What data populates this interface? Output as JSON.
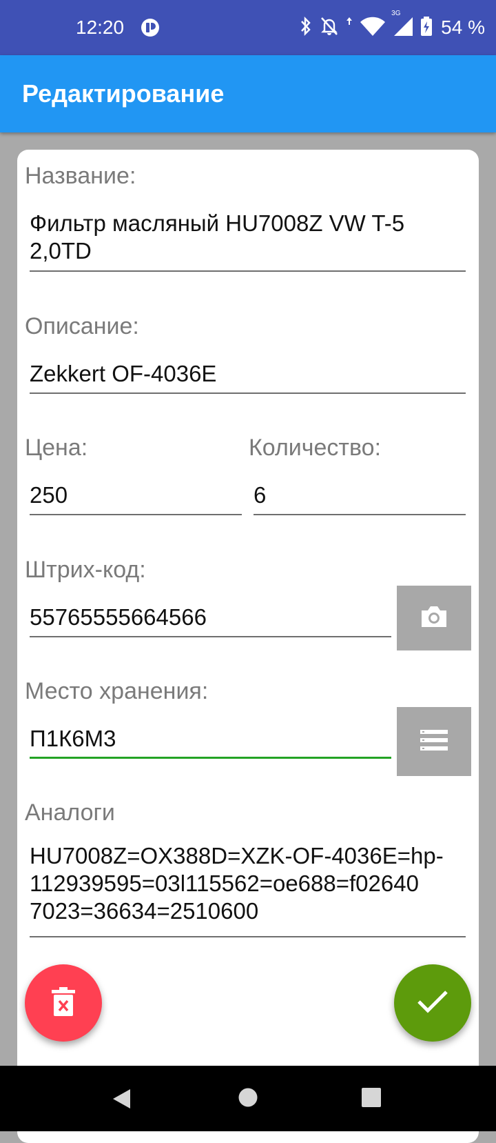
{
  "status_bar": {
    "time": "12:20",
    "battery_percent": "54 %",
    "network_type": "3G",
    "icons": [
      "app-notification-icon",
      "bluetooth-icon",
      "notifications-off-icon",
      "data-transfer-icon",
      "wifi-icon",
      "cellular-signal-icon",
      "battery-charging-icon"
    ]
  },
  "app_bar": {
    "title": "Редактирование"
  },
  "form": {
    "name": {
      "label": "Название:",
      "value": "Фильтр масляный HU7008Z VW T-5\n2,0TD"
    },
    "description": {
      "label": "Описание:",
      "value": "Zekkert OF-4036E"
    },
    "price": {
      "label": "Цена:",
      "value": "250"
    },
    "quantity": {
      "label": "Количество:",
      "value": "6"
    },
    "barcode": {
      "label": "Штрих-код:",
      "value": "55765555664566",
      "button_icon": "camera-icon"
    },
    "storage": {
      "label": "Место хранения:",
      "value": "П1К6М3",
      "button_icon": "list-icon"
    },
    "analogs": {
      "label": "Аналоги",
      "value": "HU7008Z=OX388D=XZK-OF-4036E=hp-\n112939595=03l115562=oe688=f02640\n7023=36634=2510600"
    }
  },
  "actions": {
    "delete_icon": "delete-icon",
    "confirm_icon": "check-icon"
  },
  "nav_bar": {
    "icons": [
      "back-icon",
      "home-icon",
      "recents-icon"
    ]
  },
  "colors": {
    "status_bar": "#3f51b5",
    "app_bar": "#2196f3",
    "delete_fab": "#ff4052",
    "confirm_fab": "#5d9b0c",
    "active_underline": "#23a324"
  }
}
